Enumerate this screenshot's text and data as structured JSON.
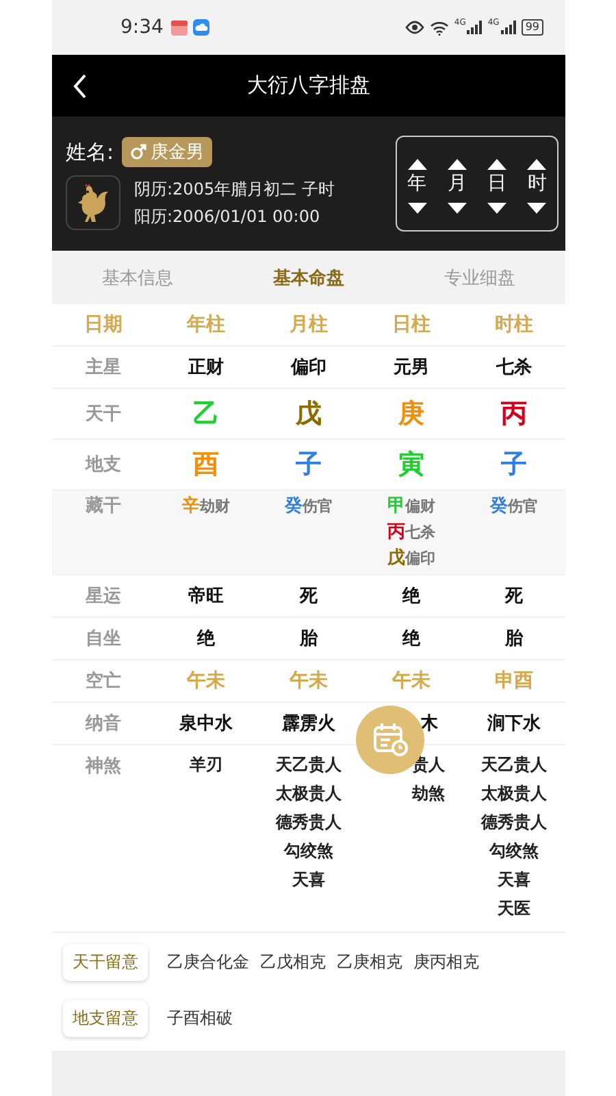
{
  "status_bar": {
    "time": "9:34",
    "network_labels": [
      "4G",
      "4G"
    ],
    "battery": "99"
  },
  "header": {
    "title": "大衍八字排盘"
  },
  "profile": {
    "name_label": "姓名:",
    "gender_badge": "庚金男",
    "lunar": "阴历:2005年腊月初二 子时",
    "solar": "阳历:2006/01/01 00:00",
    "steppers": [
      "年",
      "月",
      "日",
      "时"
    ]
  },
  "tabs": [
    {
      "label": "基本信息",
      "selected": false
    },
    {
      "label": "基本命盘",
      "selected": true
    },
    {
      "label": "专业细盘",
      "selected": false
    }
  ],
  "table": {
    "header_label": "日期",
    "columns": [
      "年柱",
      "月柱",
      "日柱",
      "时柱"
    ],
    "rows": [
      {
        "label": "主星",
        "kind": "text",
        "cells": [
          {
            "text": "正财"
          },
          {
            "text": "偏印"
          },
          {
            "text": "元男"
          },
          {
            "text": "七杀"
          }
        ]
      },
      {
        "label": "天干",
        "kind": "glyph",
        "cells": [
          {
            "text": "乙",
            "color": "#22cc33"
          },
          {
            "text": "戊",
            "color": "#8a6d00"
          },
          {
            "text": "庚",
            "color": "#f0900a"
          },
          {
            "text": "丙",
            "color": "#d0021b"
          }
        ]
      },
      {
        "label": "地支",
        "kind": "glyph",
        "cells": [
          {
            "text": "酉",
            "color": "#f0900a"
          },
          {
            "text": "子",
            "color": "#2f7fe0"
          },
          {
            "text": "寅",
            "color": "#22cc33"
          },
          {
            "text": "子",
            "color": "#2f7fe0"
          }
        ]
      },
      {
        "label": "藏干",
        "kind": "hidden",
        "cells": [
          {
            "items": [
              {
                "stem": "辛",
                "color": "#f0900a",
                "god": "劫财"
              }
            ]
          },
          {
            "items": [
              {
                "stem": "癸",
                "color": "#2f7fe0",
                "god": "伤官"
              }
            ]
          },
          {
            "items": [
              {
                "stem": "甲",
                "color": "#22cc33",
                "god": "偏财"
              },
              {
                "stem": "丙",
                "color": "#d0021b",
                "god": "七杀"
              },
              {
                "stem": "戊",
                "color": "#8a6d00",
                "god": "偏印"
              }
            ]
          },
          {
            "items": [
              {
                "stem": "癸",
                "color": "#2f7fe0",
                "god": "伤官"
              }
            ]
          }
        ]
      },
      {
        "label": "星运",
        "kind": "text",
        "cells": [
          {
            "text": "帝旺"
          },
          {
            "text": "死"
          },
          {
            "text": "绝"
          },
          {
            "text": "死"
          }
        ]
      },
      {
        "label": "自坐",
        "kind": "text",
        "cells": [
          {
            "text": "绝"
          },
          {
            "text": "胎"
          },
          {
            "text": "绝"
          },
          {
            "text": "胎"
          }
        ]
      },
      {
        "label": "空亡",
        "kind": "accent",
        "cells": [
          {
            "text": "午未"
          },
          {
            "text": "午未"
          },
          {
            "text": "午未"
          },
          {
            "text": "申酉"
          }
        ]
      },
      {
        "label": "纳音",
        "kind": "text",
        "cells": [
          {
            "text": "泉中水"
          },
          {
            "text": "霹雳火"
          },
          {
            "text": "木",
            "covered": true
          },
          {
            "text": "涧下水"
          }
        ]
      },
      {
        "label": "神煞",
        "kind": "list",
        "cells": [
          {
            "lines": [
              "羊刃"
            ]
          },
          {
            "lines": [
              "天乙贵人",
              "太极贵人",
              "德秀贵人",
              "勾绞煞",
              "天喜"
            ]
          },
          {
            "lines": [
              "贵人",
              "劫煞"
            ],
            "covered": true
          },
          {
            "lines": [
              "天乙贵人",
              "太极贵人",
              "德秀贵人",
              "勾绞煞",
              "天喜",
              "天医"
            ]
          }
        ]
      }
    ]
  },
  "notes": [
    {
      "tag": "天干留意",
      "items": [
        "乙庚合化金",
        "乙戊相克",
        "乙庚相克",
        "庚丙相克"
      ]
    },
    {
      "tag": "地支留意",
      "items": [
        "子酉相破"
      ]
    }
  ]
}
